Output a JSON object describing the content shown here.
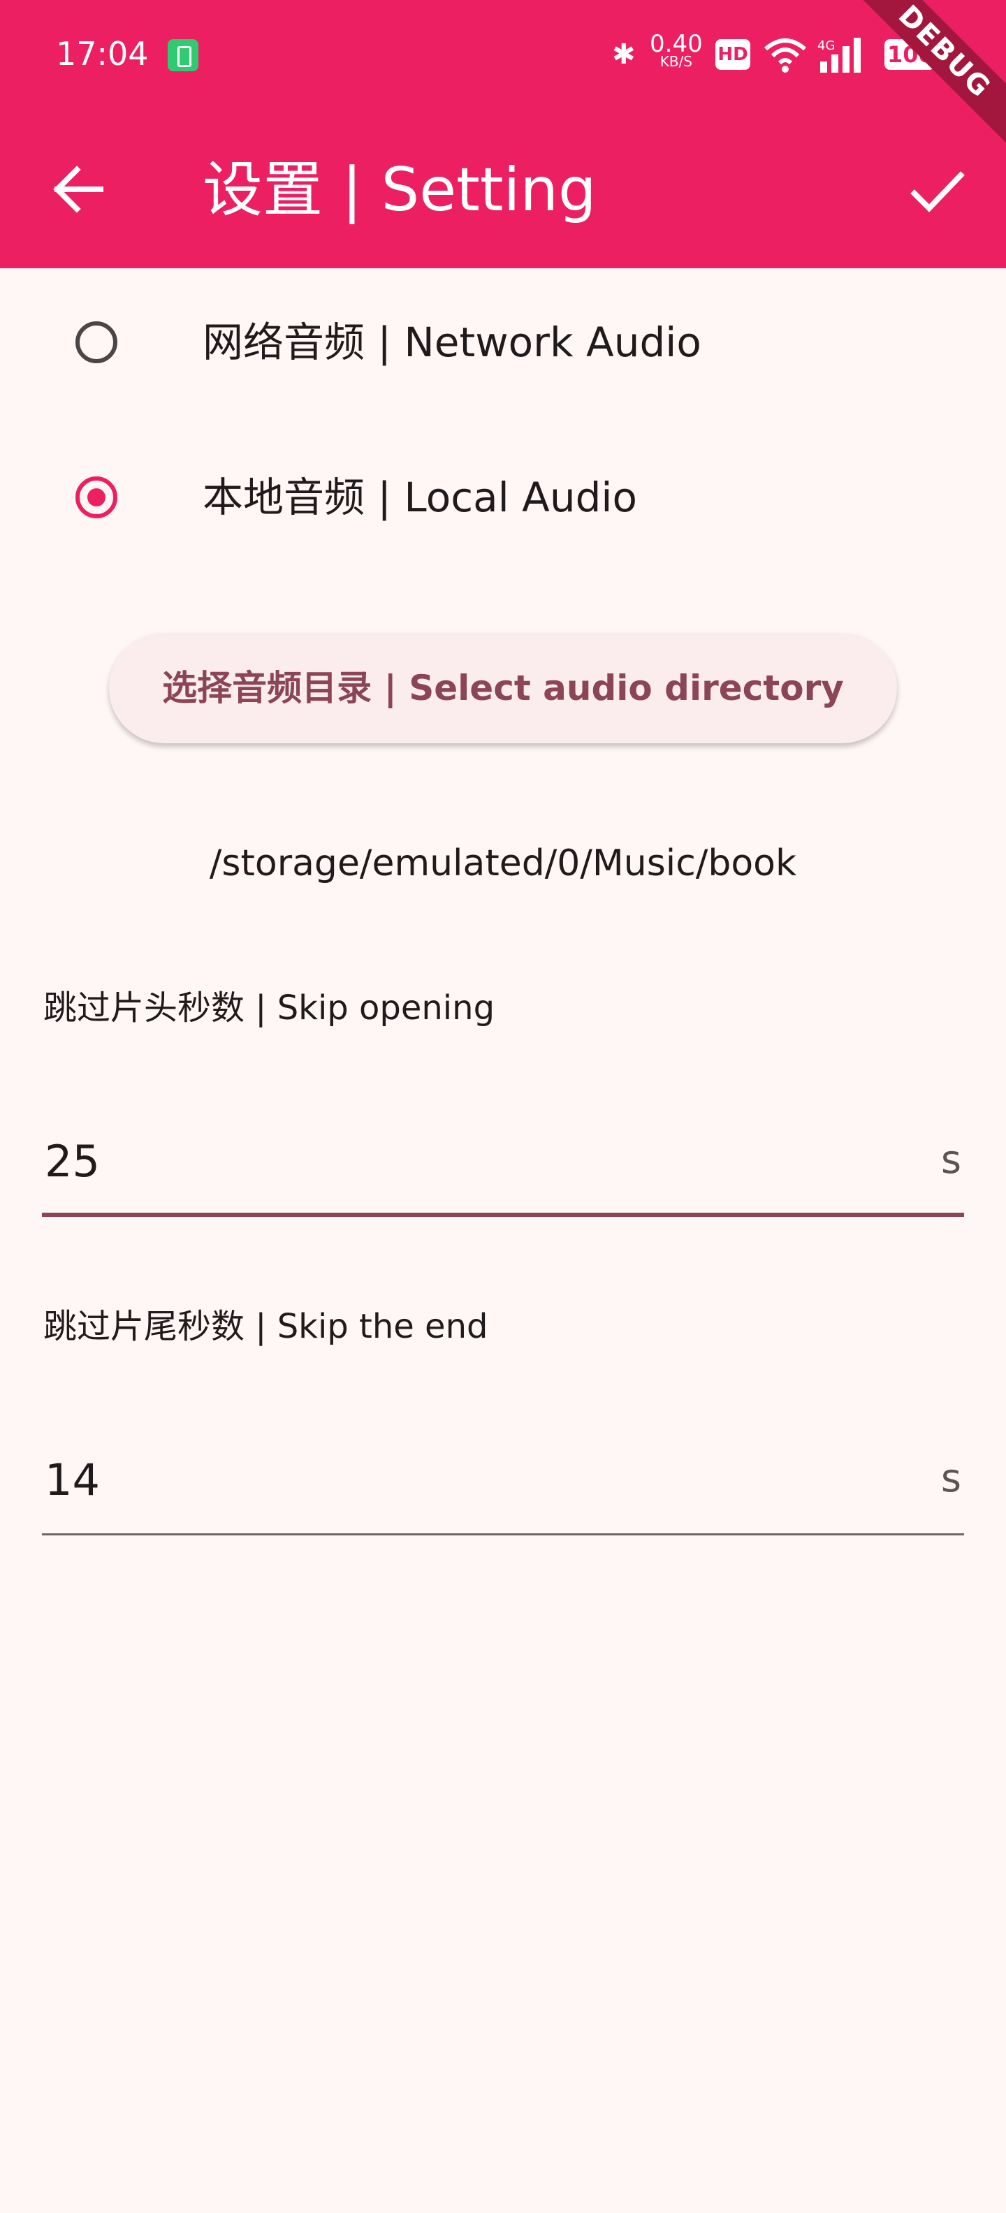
{
  "status_bar": {
    "time": "17:04",
    "network_speed": "0.40",
    "network_unit": "KB/S",
    "hd": "HD",
    "cell_type": "4G",
    "battery": "100",
    "debug_banner": "DEBUG"
  },
  "app_bar": {
    "title": "设置 | Setting",
    "background_color": "#EC1F63"
  },
  "audio_source": {
    "options": [
      {
        "label": "网络音频 | Network Audio",
        "selected": false
      },
      {
        "label": "本地音频 | Local Audio",
        "selected": true
      }
    ]
  },
  "directory": {
    "button_label": "选择音频目录 | Select audio directory",
    "selected_path": "/storage/emulated/0/Music/book"
  },
  "skip_opening": {
    "label": "跳过片头秒数 | Skip opening",
    "value": "25",
    "suffix": "s"
  },
  "skip_end": {
    "label": "跳过片尾秒数 | Skip the end",
    "value": "14",
    "suffix": "s"
  },
  "colors": {
    "accent": "#EC1F63",
    "button_text": "#8B4556",
    "background": "#FFF7F6"
  }
}
